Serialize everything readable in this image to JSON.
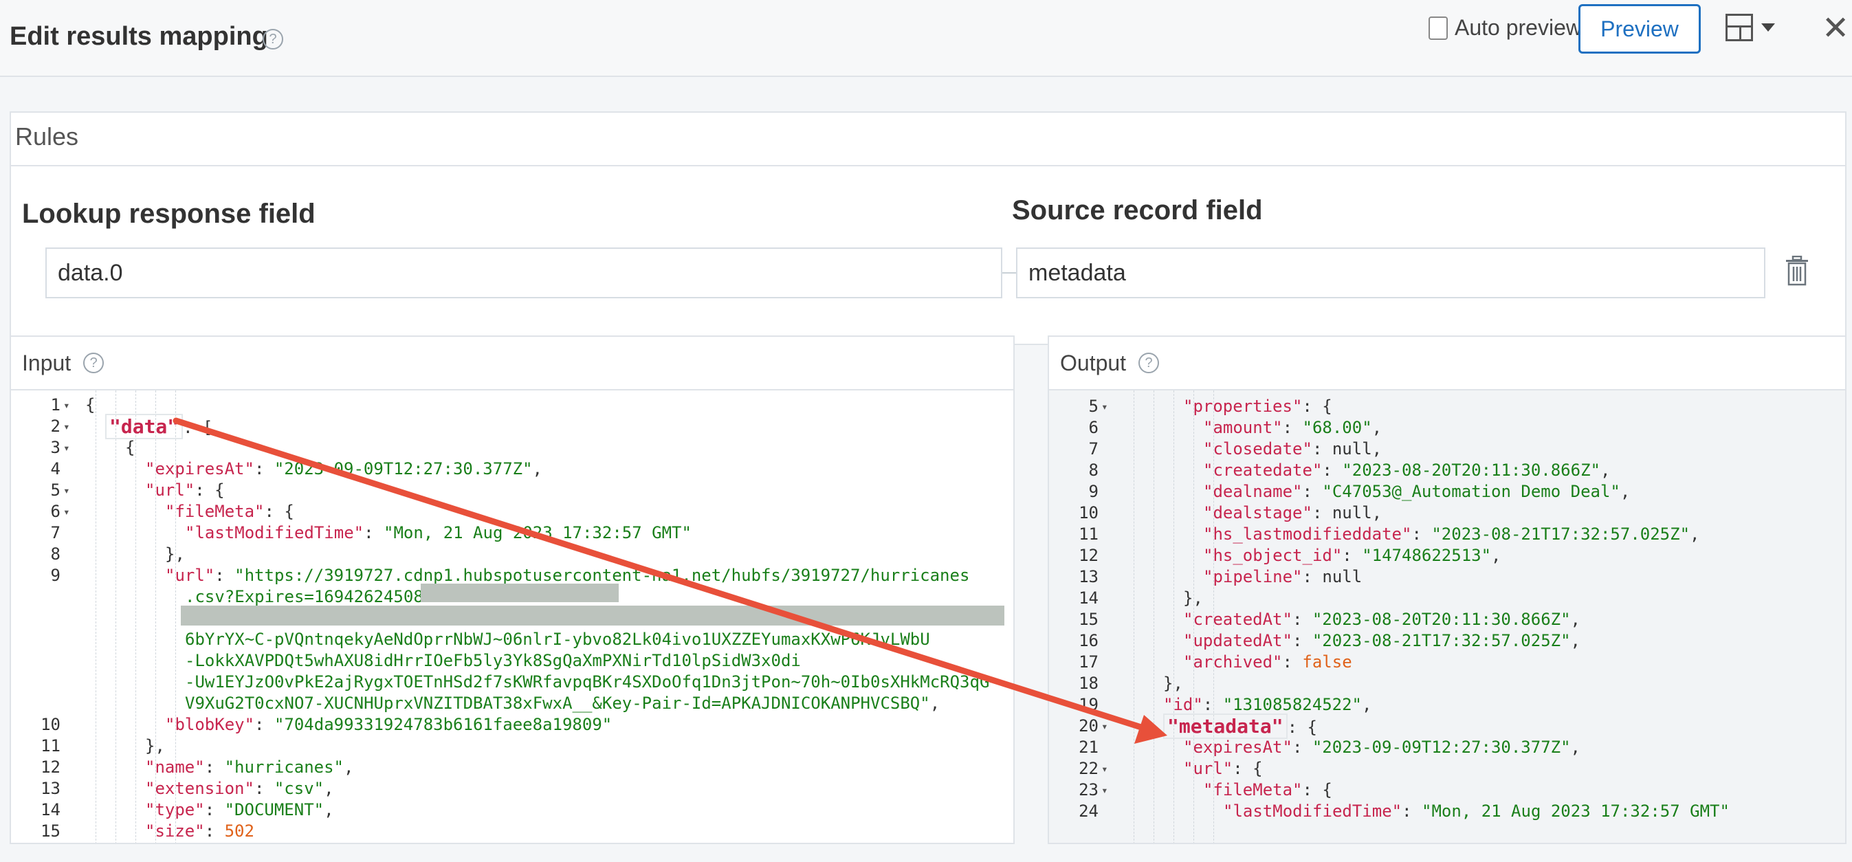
{
  "header": {
    "title": "Edit results mapping",
    "auto_preview_label": "Auto preview",
    "preview_label": "Preview"
  },
  "rules": {
    "title": "Rules",
    "lookup_label": "Lookup response field",
    "source_label": "Source record field",
    "lookup_value": "data.0",
    "source_value": "metadata"
  },
  "input": {
    "title": "Input",
    "lines": [
      {
        "n": "1",
        "fold": true,
        "indent": 0,
        "html": "{"
      },
      {
        "n": "2",
        "fold": true,
        "indent": 1,
        "key": "data",
        "rest": ": ["
      },
      {
        "n": "3",
        "fold": true,
        "indent": 2,
        "html": "{"
      },
      {
        "n": "4",
        "fold": false,
        "indent": 3,
        "key": "expiresAt",
        "str": "2023-09-09T12:27:30.377Z",
        "tail": ","
      },
      {
        "n": "5",
        "fold": true,
        "indent": 3,
        "key": "url",
        "rest": ": {"
      },
      {
        "n": "6",
        "fold": true,
        "indent": 4,
        "key": "fileMeta",
        "rest": ": {"
      },
      {
        "n": "7",
        "fold": false,
        "indent": 5,
        "key": "lastModifiedTime",
        "str": "Mon, 21 Aug 2023 17:32:57 GMT"
      },
      {
        "n": "8",
        "fold": false,
        "indent": 4,
        "html": "},"
      },
      {
        "n": "9",
        "fold": false,
        "indent": 4,
        "key": "url",
        "str_open": "https://3919727.cdnp1.hubspotusercontent-na1.net/hubfs/3919727/hurricanes"
      },
      {
        "n": "",
        "fold": false,
        "indent": 5,
        "cont": ".csv?Expires=16942624508"
      },
      {
        "n": "",
        "fold": false,
        "indent": 5,
        "cont": ""
      },
      {
        "n": "",
        "fold": false,
        "indent": 5,
        "cont": "6bYrYX~C-pVQntnqekyAeNdOprrNbWJ~06nlrI-ybvo82Lk04ivo1UXZZEYumaxKXwP6KJvLWbU"
      },
      {
        "n": "",
        "fold": false,
        "indent": 5,
        "cont": "-LokkXAVPDQt5whAXU8idHrrIOeFb5ly3Yk8SgQaXmPXNirTd10lpSidW3x0di"
      },
      {
        "n": "",
        "fold": false,
        "indent": 5,
        "cont": "-Uw1EYJzO0vPkE2ajRygxTOETnHSd2f7sKWRfavpqBKr4SXDoOfq1Dn3jtPon~70h~0Ib0sXHkMcRQ3qG"
      },
      {
        "n": "",
        "fold": false,
        "indent": 5,
        "cont_end": "V9XuG2T0cxNO7-XUCNHUprxVNZITDBAT38xFwxA__&Key-Pair-Id=APKAJDNICOKANPHVCSBQ",
        "tail": ","
      },
      {
        "n": "10",
        "fold": false,
        "indent": 4,
        "key": "blobKey",
        "str": "704da99331924783b6161faee8a19809"
      },
      {
        "n": "11",
        "fold": false,
        "indent": 3,
        "html": "},"
      },
      {
        "n": "12",
        "fold": false,
        "indent": 3,
        "key": "name",
        "str": "hurricanes",
        "tail": ","
      },
      {
        "n": "13",
        "fold": false,
        "indent": 3,
        "key": "extension",
        "str": "csv",
        "tail": ","
      },
      {
        "n": "14",
        "fold": false,
        "indent": 3,
        "key": "type",
        "str": "DOCUMENT",
        "tail": ","
      },
      {
        "n": "15",
        "fold": false,
        "indent": 3,
        "key": "size",
        "num": "502"
      }
    ]
  },
  "output": {
    "title": "Output",
    "lines": [
      {
        "n": "5",
        "fold": true,
        "indent": 3,
        "key": "properties",
        "rest": ": {"
      },
      {
        "n": "6",
        "fold": false,
        "indent": 4,
        "key": "amount",
        "str": "68.00",
        "tail": ","
      },
      {
        "n": "7",
        "fold": false,
        "indent": 4,
        "key": "closedate",
        "rest": ": null,"
      },
      {
        "n": "8",
        "fold": false,
        "indent": 4,
        "key": "createdate",
        "str": "2023-08-20T20:11:30.866Z",
        "tail": ","
      },
      {
        "n": "9",
        "fold": false,
        "indent": 4,
        "key": "dealname",
        "str": "C47053@_Automation Demo Deal",
        "tail": ","
      },
      {
        "n": "10",
        "fold": false,
        "indent": 4,
        "key": "dealstage",
        "rest": ": null,"
      },
      {
        "n": "11",
        "fold": false,
        "indent": 4,
        "key": "hs_lastmodifieddate",
        "str": "2023-08-21T17:32:57.025Z",
        "tail": ","
      },
      {
        "n": "12",
        "fold": false,
        "indent": 4,
        "key": "hs_object_id",
        "str": "14748622513",
        "tail": ","
      },
      {
        "n": "13",
        "fold": false,
        "indent": 4,
        "key": "pipeline",
        "rest": ": null"
      },
      {
        "n": "14",
        "fold": false,
        "indent": 3,
        "html": "},"
      },
      {
        "n": "15",
        "fold": false,
        "indent": 3,
        "key": "createdAt",
        "str": "2023-08-20T20:11:30.866Z",
        "tail": ","
      },
      {
        "n": "16",
        "fold": false,
        "indent": 3,
        "key": "updatedAt",
        "str": "2023-08-21T17:32:57.025Z",
        "tail": ","
      },
      {
        "n": "17",
        "fold": false,
        "indent": 3,
        "key": "archived",
        "bool": "false"
      },
      {
        "n": "18",
        "fold": false,
        "indent": 2,
        "html": "},"
      },
      {
        "n": "19",
        "fold": false,
        "indent": 2,
        "key": "id",
        "str": "131085824522",
        "tail": ","
      },
      {
        "n": "20",
        "fold": true,
        "indent": 2,
        "key": "metadata",
        "rest": ": {"
      },
      {
        "n": "21",
        "fold": false,
        "indent": 3,
        "key": "expiresAt",
        "str": "2023-09-09T12:27:30.377Z",
        "tail": ","
      },
      {
        "n": "22",
        "fold": true,
        "indent": 3,
        "key": "url",
        "rest": ": {"
      },
      {
        "n": "23",
        "fold": true,
        "indent": 4,
        "key": "fileMeta",
        "rest": ": {"
      },
      {
        "n": "24",
        "fold": false,
        "indent": 5,
        "key": "lastModifiedTime",
        "str": "Mon, 21 Aug 2023 17:32:57 GMT"
      }
    ]
  },
  "colors": {
    "accent": "#1e70c1",
    "json_key": "#c7254e",
    "json_string": "#1a7f1a",
    "json_bool": "#e0621a",
    "annotation_arrow": "#e8503a"
  }
}
